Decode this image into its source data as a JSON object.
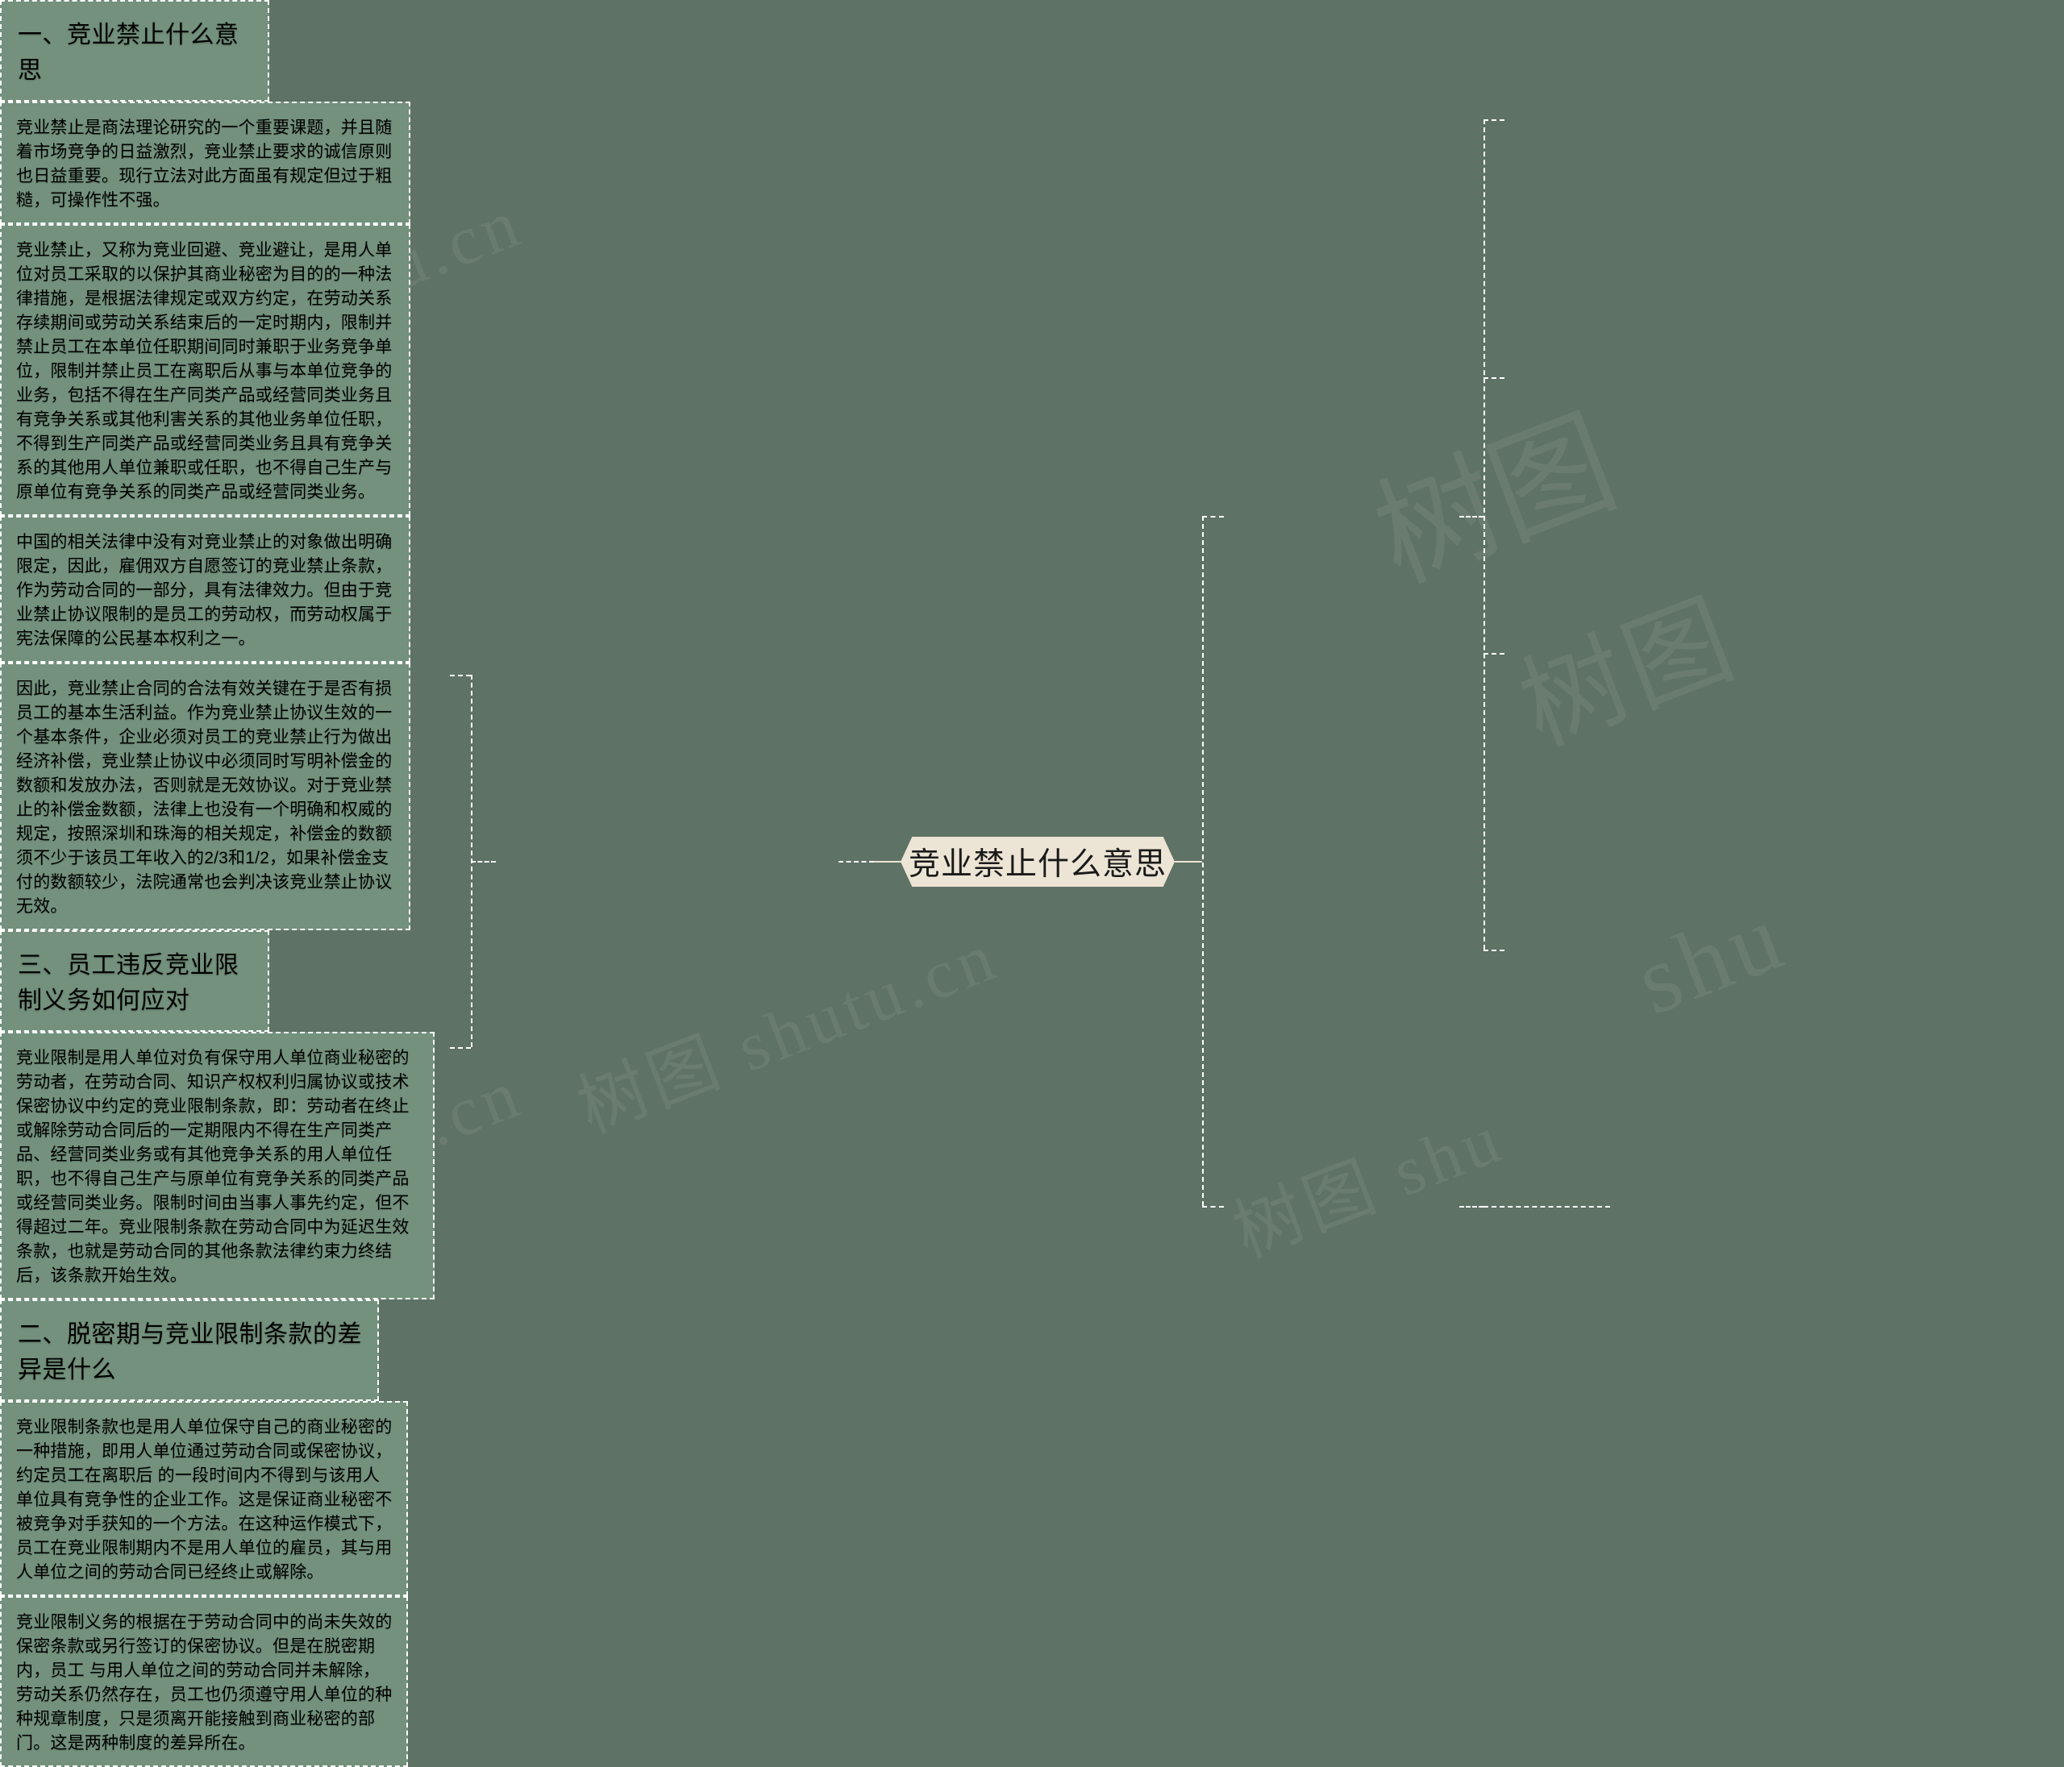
{
  "page": {
    "background_color": "#5e7265",
    "node_fill_color": "#73917c",
    "root_fill_color": "#ece4d4",
    "line_color": "#ffffff",
    "text_color": "#ffffff",
    "root_text_color": "#1a1a1a"
  },
  "watermarks": {
    "w1": "树图 shutu.cn",
    "w2": "树图 shutu.cn",
    "w3": "树图 shu",
    "w4": "树图",
    "w5": "树图 shutu.cn",
    "w6": "shu",
    "w7": "树图"
  },
  "mindmap": {
    "root": {
      "label": "竞业禁止什么意思"
    },
    "branches": [
      {
        "id": "branch-1",
        "label": "一、竞业禁止什么意思",
        "side": "right",
        "leaves": [
          {
            "id": "leaf-1-1",
            "text": "竞业禁止是商法理论研究的一个重要课题，并且随着市场竞争的日益激烈，竞业禁止要求的诚信原则也日益重要。现行立法对此方面虽有规定但过于粗糙，可操作性不强。"
          },
          {
            "id": "leaf-1-2",
            "text": "竞业禁止，又称为竞业回避、竞业避让，是用人单位对员工采取的以保护其商业秘密为目的的一种法律措施，是根据法律规定或双方约定，在劳动关系存续期间或劳动关系结束后的一定时期内，限制并禁止员工在本单位任职期间同时兼职于业务竞争单位，限制并禁止员工在离职后从事与本单位竞争的业务，包括不得在生产同类产品或经营同类业务且有竞争关系或其他利害关系的其他业务单位任职，不得到生产同类产品或经营同类业务且具有竞争关系的其他用人单位兼职或任职，也不得自己生产与原单位有竞争关系的同类产品或经营同类业务。"
          },
          {
            "id": "leaf-1-3",
            "text": "中国的相关法律中没有对竞业禁止的对象做出明确限定，因此，雇佣双方自愿签订的竞业禁止条款，作为劳动合同的一部分，具有法律效力。但由于竞业禁止协议限制的是员工的劳动权，而劳动权属于宪法保障的公民基本权利之一。"
          },
          {
            "id": "leaf-1-4",
            "text": "因此，竞业禁止合同的合法有效关键在于是否有损员工的基本生活利益。作为竞业禁止协议生效的一个基本条件，企业必须对员工的竞业禁止行为做出经济补偿，竞业禁止协议中必须同时写明补偿金的数额和发放办法，否则就是无效协议。对于竞业禁止的补偿金数额，法律上也没有一个明确和权威的规定，按照深圳和珠海的相关规定，补偿金的数额须不少于该员工年收入的2/3和1/2，如果补偿金支付的数额较少，法院通常也会判决该竞业禁止协议无效。"
          }
        ]
      },
      {
        "id": "branch-2",
        "label": "二、脱密期与竞业限制条款的差异是什么",
        "side": "left",
        "leaves": [
          {
            "id": "leaf-2-1",
            "text": "竞业限制条款也是用人单位保守自己的商业秘密的一种措施，即用人单位通过劳动合同或保密协议，约定员工在离职后 的一段时间内不得到与该用人单位具有竞争性的企业工作。这是保证商业秘密不被竞争对手获知的一个方法。在这种运作模式下，员工在竞业限制期内不是用人单位的雇员，其与用人单位之间的劳动合同已经终止或解除。"
          },
          {
            "id": "leaf-2-2",
            "text": "竞业限制义务的根据在于劳动合同中的尚未失效的保密条款或另行签订的保密协议。但是在脱密期内，员工 与用人单位之间的劳动合同并未解除，劳动关系仍然存在，员工也仍须遵守用人单位的种种规章制度，只是须离开能接触到商业秘密的部门。这是两种制度的差异所在。"
          }
        ]
      },
      {
        "id": "branch-3",
        "label": "三、员工违反竞业限制义务如何应对",
        "side": "right",
        "leaves": [
          {
            "id": "leaf-3-1",
            "text": "竞业限制是用人单位对负有保守用人单位商业秘密的劳动者，在劳动合同、知识产权权利归属协议或技术保密协议中约定的竞业限制条款，即：劳动者在终止或解除劳动合同后的一定期限内不得在生产同类产品、经营同类业务或有其他竞争关系的用人单位任职，也不得自己生产与原单位有竞争关系的同类产品或经营同类业务。限制时间由当事人事先约定，但不得超过二年。竞业限制条款在劳动合同中为延迟生效条款，也就是劳动合同的其他条款法律约束力终结后，该条款开始生效。"
          }
        ]
      }
    ]
  }
}
